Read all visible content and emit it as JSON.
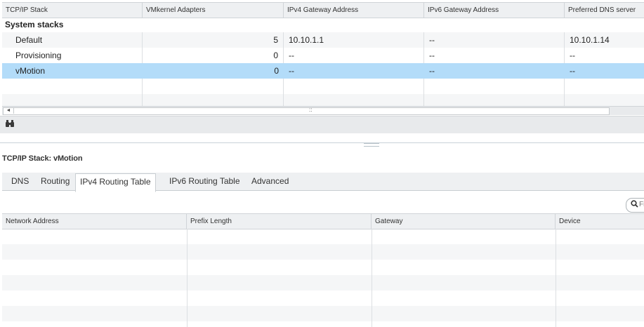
{
  "stacks_table": {
    "columns": [
      "TCP/IP Stack",
      "VMkernel Adapters",
      "IPv4 Gateway Address",
      "IPv6 Gateway Address",
      "Preferred DNS server"
    ],
    "group_label": "System stacks",
    "rows": [
      {
        "name": "Default",
        "adapters": "5",
        "ipv4": "10.10.1.1",
        "ipv6": "--",
        "dns": "10.10.1.14"
      },
      {
        "name": "Provisioning",
        "adapters": "0",
        "ipv4": "--",
        "ipv6": "--",
        "dns": "--"
      },
      {
        "name": "vMotion",
        "adapters": "0",
        "ipv4": "--",
        "ipv6": "--",
        "dns": "--"
      }
    ],
    "selected_row": "vMotion"
  },
  "scrollbar": {
    "left_arrow": "◄",
    "grip": "::"
  },
  "find_icon": "binoculars-icon",
  "detail": {
    "title": "TCP/IP Stack: vMotion",
    "tabs": [
      "DNS",
      "Routing",
      "IPv4 Routing Table",
      "IPv6 Routing Table",
      "Advanced"
    ],
    "active_tab": "IPv4 Routing Table",
    "search": {
      "placeholder": "Filter",
      "icon": "search-icon"
    },
    "routing_table": {
      "columns": [
        "Network Address",
        "Prefix Length",
        "Gateway",
        "Device"
      ],
      "rows": []
    }
  },
  "colors": {
    "selected_row": "#b3dcf9",
    "header_bg": "#eef0f2",
    "alt_row": "#f5f6f7"
  }
}
